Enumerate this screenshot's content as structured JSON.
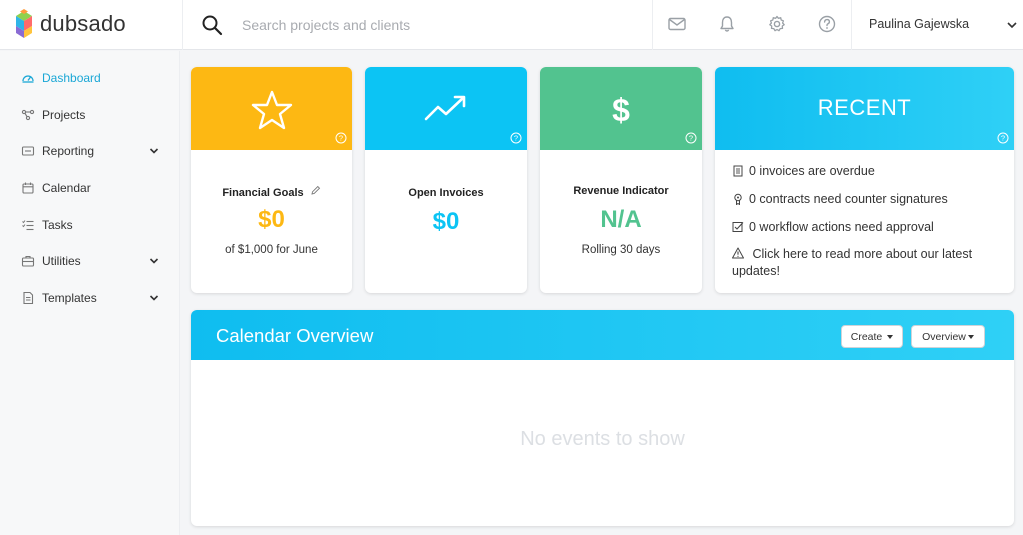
{
  "app": {
    "name": "dubsado"
  },
  "search": {
    "placeholder": "Search projects and clients"
  },
  "header": {
    "icons": [
      "mail-icon",
      "bell-icon",
      "gear-icon",
      "help-icon"
    ],
    "user_name": "Paulina Gajewska"
  },
  "sidebar": {
    "items": [
      {
        "label": "Dashboard",
        "icon": "dashboard-icon",
        "active": true,
        "has_chevron": false
      },
      {
        "label": "Projects",
        "icon": "projects-icon",
        "active": false,
        "has_chevron": false
      },
      {
        "label": "Reporting",
        "icon": "reporting-icon",
        "active": false,
        "has_chevron": true
      },
      {
        "label": "Calendar",
        "icon": "calendar-icon",
        "active": false,
        "has_chevron": false
      },
      {
        "label": "Tasks",
        "icon": "tasks-icon",
        "active": false,
        "has_chevron": false
      },
      {
        "label": "Utilities",
        "icon": "utilities-icon",
        "active": false,
        "has_chevron": true
      },
      {
        "label": "Templates",
        "icon": "templates-icon",
        "active": false,
        "has_chevron": true
      }
    ]
  },
  "cards": {
    "financial": {
      "title": "Financial Goals",
      "value": "$0",
      "sub": "of $1,000 for June",
      "color": "#fdb813",
      "icon": "star-icon"
    },
    "invoices": {
      "title": "Open Invoices",
      "value": "$0",
      "color": "#0cc4f4",
      "icon": "trend-up-icon"
    },
    "revenue": {
      "title": "Revenue Indicator",
      "value": "N/A",
      "sub": "Rolling 30 days",
      "color": "#52c38f",
      "icon": "dollar-icon"
    },
    "recent": {
      "title": "RECENT",
      "lines": [
        "0 invoices are overdue",
        "0 contracts need counter signatures",
        "0 workflow actions need approval",
        "Click here to read more about our latest updates!"
      ]
    }
  },
  "calendar": {
    "title": "Calendar Overview",
    "create_label": "Create",
    "view_label": "Overview",
    "empty_text": "No events to show"
  },
  "colors": {
    "accent": "#1aa7d6",
    "blue": "#0cc4f4",
    "yellow": "#fdb813",
    "green": "#52c38f"
  }
}
